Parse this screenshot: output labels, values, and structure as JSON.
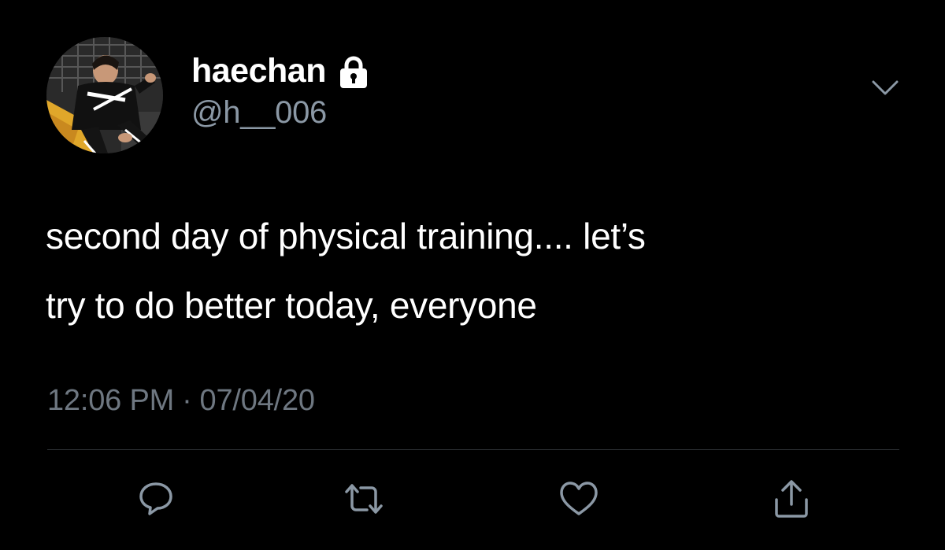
{
  "user": {
    "display_name": "haechan",
    "handle": "@h__006",
    "protected_icon": "lock-icon",
    "avatar_icon": "profile-photo"
  },
  "tweet": {
    "text_line1": "second day of physical training.... let’s",
    "text_line2": "try to do better today, everyone",
    "time": "12:06 PM",
    "separator": "·",
    "date": "07/04/20"
  },
  "menu": {
    "icon": "chevron-down-icon"
  },
  "actions": [
    {
      "name": "reply",
      "icon": "reply-icon"
    },
    {
      "name": "retweet",
      "icon": "retweet-icon"
    },
    {
      "name": "like",
      "icon": "heart-icon"
    },
    {
      "name": "share",
      "icon": "share-icon"
    }
  ],
  "colors": {
    "background": "#000000",
    "primary_text": "#ffffff",
    "secondary_text": "#8b98a5",
    "icon_gray": "#8b98a5",
    "divider": "#2f3336"
  }
}
